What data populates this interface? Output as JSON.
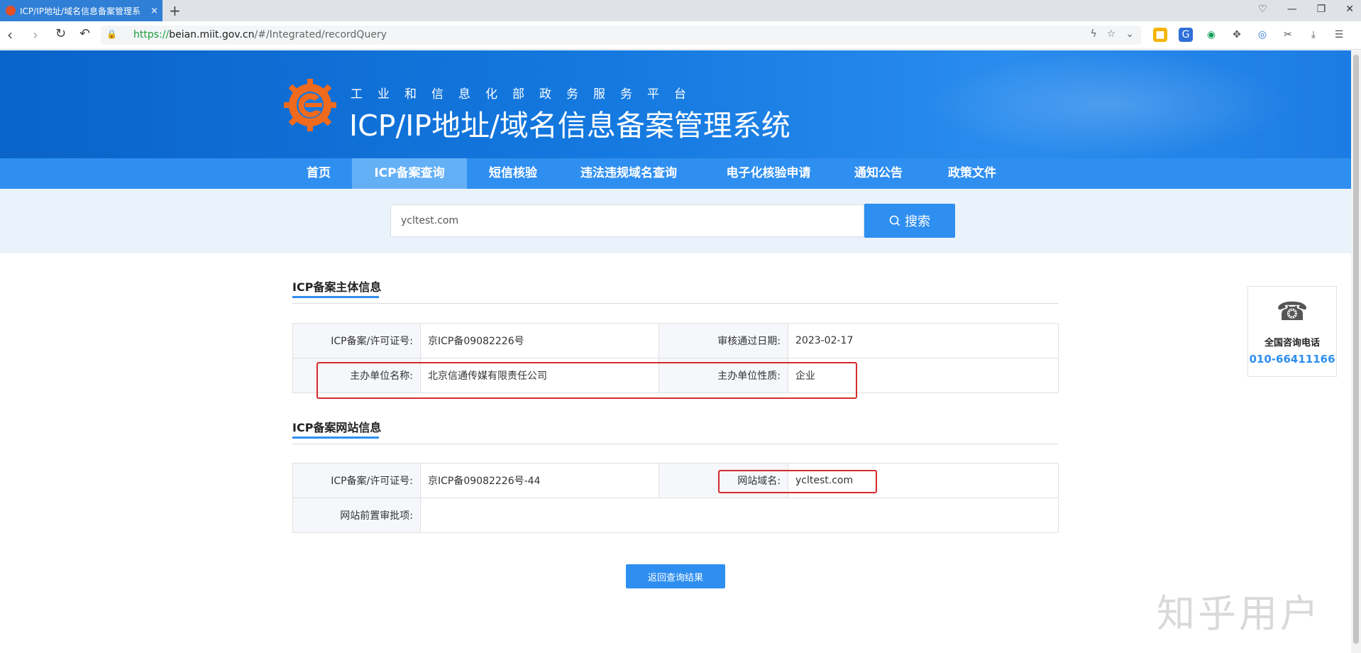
{
  "browser": {
    "tab_title": "ICP/IP地址/域名信息备案管理系",
    "tab_close": "×",
    "new_tab": "+",
    "url_scheme": "https://",
    "url_host": "beian.miit.gov.cn",
    "url_path": "/#/Integrated/recordQuery"
  },
  "header": {
    "subtitle": "工业和信息化部政务服务平台",
    "title": "ICP/IP地址/域名信息备案管理系统"
  },
  "nav": {
    "items": [
      {
        "label": "首页"
      },
      {
        "label": "ICP备案查询"
      },
      {
        "label": "短信核验"
      },
      {
        "label": "违法违规域名查询"
      },
      {
        "label": "电子化核验申请"
      },
      {
        "label": "通知公告"
      },
      {
        "label": "政策文件"
      }
    ],
    "active_index": 1
  },
  "search": {
    "value": "ycltest.com",
    "button_label": "搜索"
  },
  "subject_info": {
    "title": "ICP备案主体信息",
    "license_label": "ICP备案/许可证号:",
    "license_value": "京ICP备09082226号",
    "approve_date_label": "审核通过日期:",
    "approve_date_value": "2023-02-17",
    "org_name_label": "主办单位名称:",
    "org_name_value": "北京信通传媒有限责任公司",
    "org_type_label": "主办单位性质:",
    "org_type_value": "企业"
  },
  "site_info": {
    "title": "ICP备案网站信息",
    "license_label": "ICP备案/许可证号:",
    "license_value": "京ICP备09082226号-44",
    "domain_label": "网站域名:",
    "domain_value": "ycltest.com",
    "preapproval_label": "网站前置审批项:",
    "preapproval_value": ""
  },
  "back_button": "返回查询结果",
  "side_widget": {
    "label": "全国咨询电话",
    "phone": "010-66411166"
  },
  "watermark": "知乎用户",
  "colors": {
    "primary": "#2f8ff0",
    "banner": "#1479e0",
    "highlight": "#d42b2b"
  }
}
